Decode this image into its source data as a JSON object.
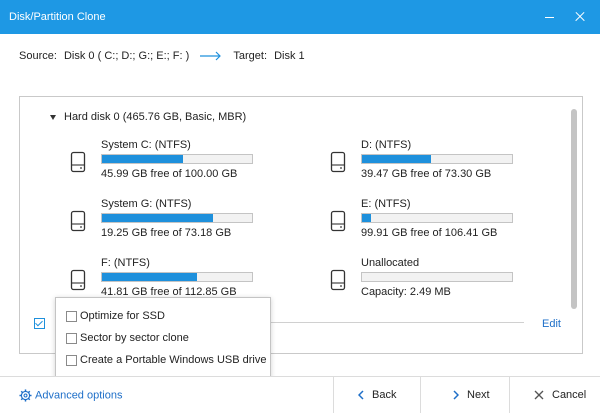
{
  "window": {
    "title": "Disk/Partition Clone"
  },
  "source": {
    "source_label": "Source:",
    "source_value": "Disk 0 ( C:; D:; G:; E:; F: )",
    "target_label": "Target:",
    "target_value": "Disk 1"
  },
  "disk": {
    "header": "Hard disk 0 (465.76 GB, Basic, MBR)"
  },
  "partitions": [
    {
      "name": "System C: (NTFS)",
      "free_text": "45.99 GB free of 100.00 GB",
      "used_fraction": 0.54
    },
    {
      "name": "D: (NTFS)",
      "free_text": "39.47 GB free of 73.30 GB",
      "used_fraction": 0.46
    },
    {
      "name": "System G: (NTFS)",
      "free_text": "19.25 GB free of 73.18 GB",
      "used_fraction": 0.74
    },
    {
      "name": "E: (NTFS)",
      "free_text": "99.91 GB free of 106.41 GB",
      "used_fraction": 0.06
    },
    {
      "name": "F: (NTFS)",
      "free_text": "41.81 GB free of 112.85 GB",
      "used_fraction": 0.63
    },
    {
      "name": "Unallocated",
      "free_text": "Capacity: 2.49 MB",
      "used_fraction": 0.0
    }
  ],
  "disk1": {
    "checked": true,
    "edit_label": "Edit"
  },
  "options": {
    "items": [
      {
        "label": "Optimize for SSD",
        "checked": false
      },
      {
        "label": "Sector by sector clone",
        "checked": false
      },
      {
        "label": "Create a Portable Windows USB drive",
        "checked": false
      }
    ]
  },
  "footer": {
    "advanced_label": "Advanced options",
    "back_label": "Back",
    "next_label": "Next",
    "cancel_label": "Cancel"
  },
  "colors": {
    "accent": "#1e98e4",
    "bar_fill": "#1e90dc",
    "link": "#1e6fc8"
  },
  "icons": [
    "drive-icon",
    "arrow-right-icon",
    "gear-icon",
    "chevron-left-icon",
    "chevron-right-icon",
    "close-icon",
    "minimize-icon",
    "collapse-triangle-icon",
    "check-icon"
  ]
}
